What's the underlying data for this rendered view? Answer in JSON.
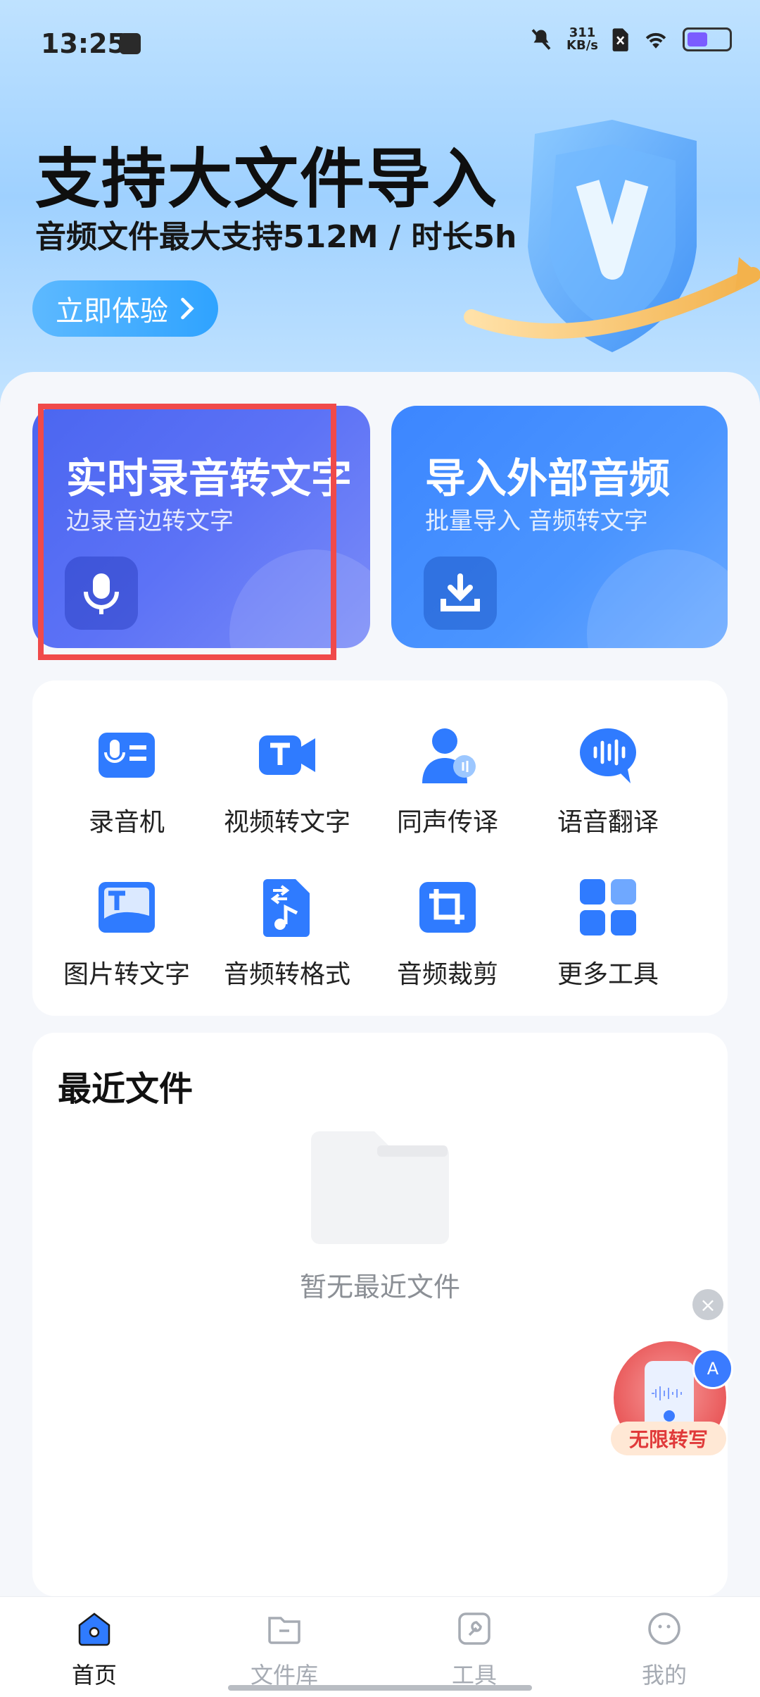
{
  "status_bar": {
    "time": "13:25",
    "net_speed_value": "311",
    "net_speed_unit": "KB/s",
    "icons": [
      "sd-card-icon",
      "mute-icon",
      "sim-icon",
      "wifi-icon",
      "battery-icon"
    ]
  },
  "hero": {
    "title": "支持大文件导入",
    "subtitle": "音频文件最大支持512M / 时长5h",
    "cta_label": "立即体验"
  },
  "cards": [
    {
      "title": "实时录音转文字",
      "subtitle": "边录音边转文字",
      "icon": "mic-icon"
    },
    {
      "title": "导入外部音频",
      "subtitle": "批量导入 音频转文字",
      "icon": "import-icon"
    }
  ],
  "tools": [
    {
      "label": "录音机",
      "icon": "recorder-icon"
    },
    {
      "label": "视频转文字",
      "icon": "video-text-icon"
    },
    {
      "label": "同声传译",
      "icon": "interpreter-icon"
    },
    {
      "label": "语音翻译",
      "icon": "voice-translate-icon"
    },
    {
      "label": "图片转文字",
      "icon": "image-text-icon"
    },
    {
      "label": "音频转格式",
      "icon": "audio-format-icon"
    },
    {
      "label": "音频裁剪",
      "icon": "audio-crop-icon"
    },
    {
      "label": "更多工具",
      "icon": "more-tools-icon"
    }
  ],
  "recent": {
    "title": "最近文件",
    "empty_text": "暂无最近文件"
  },
  "promo": {
    "label": "无限转写"
  },
  "bottom_nav": [
    {
      "label": "首页",
      "icon": "home-icon",
      "active": true
    },
    {
      "label": "文件库",
      "icon": "folder-icon",
      "active": false
    },
    {
      "label": "工具",
      "icon": "tools-icon",
      "active": false
    },
    {
      "label": "我的",
      "icon": "profile-icon",
      "active": false
    }
  ],
  "colors": {
    "accent": "#2f7bff",
    "highlight_border": "#f04a4a"
  }
}
